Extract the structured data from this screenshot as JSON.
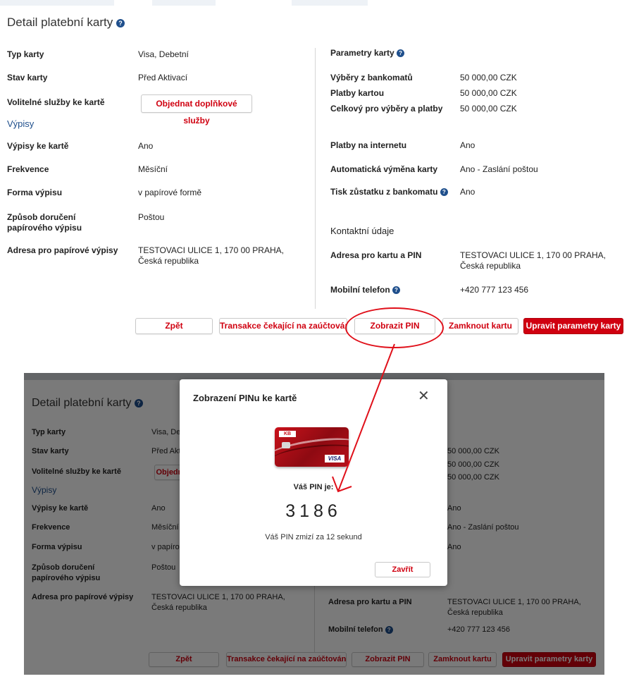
{
  "page": {
    "title": "Detail platební karty",
    "help_glyph": "?"
  },
  "left": {
    "card_type_label": "Typ karty",
    "card_type_value": "Visa, Debetní",
    "card_status_label": "Stav karty",
    "card_status_value": "Před Aktivací",
    "optional_services_label": "Volitelné služby ke kartě",
    "order_services_button": "Objednat doplňkové služby",
    "statements_heading": "Výpisy",
    "statements_label": "Výpisy ke kartě",
    "statements_value": "Ano",
    "frequency_label": "Frekvence",
    "frequency_value": "Měsíční",
    "form_label": "Forma výpisu",
    "form_value": "v papírové formě",
    "delivery_label": "Způsob doručení papírového výpisu",
    "delivery_value": "Poštou",
    "address_label": "Adresa pro papírové výpisy",
    "address_value": "TESTOVACI ULICE 1, 170  00 PRAHA, Česká republika"
  },
  "right": {
    "params_heading": "Parametry karty",
    "atm_label": "Výběry z bankomatů",
    "atm_value": "50 000,00 CZK",
    "payments_label": "Platby kartou",
    "payments_value": "50 000,00 CZK",
    "total_label": "Celkový pro výběry a platby",
    "total_value": "50 000,00 CZK",
    "internet_label": "Platby na internetu",
    "internet_value": "Ano",
    "auto_exchange_label": "Automatická výměna karty",
    "auto_exchange_value": "Ano - Zaslání poštou",
    "balance_print_label": "Tisk zůstatku z bankomatu",
    "balance_print_value": "Ano",
    "contact_heading": "Kontaktní údaje",
    "card_address_label": "Adresa pro kartu a PIN",
    "card_address_value": "TESTOVACI ULICE 1, 170 00 PRAHA, Česká republika",
    "phone_label": "Mobilní telefon",
    "phone_value": "+420 777 123 456"
  },
  "actions": {
    "back": "Zpět",
    "pending": "Transakce čekající na zaúčtování",
    "show_pin": "Zobrazit PIN",
    "lock": "Zamknout kartu",
    "edit": "Upravit parametry karty"
  },
  "modal": {
    "title": "Zobrazení PINu ke kartě",
    "close_glyph": "✕",
    "card_brand": "KB",
    "card_network": "VISA",
    "pin_label": "Váš PIN je:",
    "pin_value": "3186",
    "pin_note": "Váš PIN zmizí za 12 sekund",
    "close_button": "Zavřít"
  },
  "colors": {
    "accent_red": "#d00010",
    "link_blue": "#1f4f8c",
    "annotation_red": "#e0101a"
  }
}
